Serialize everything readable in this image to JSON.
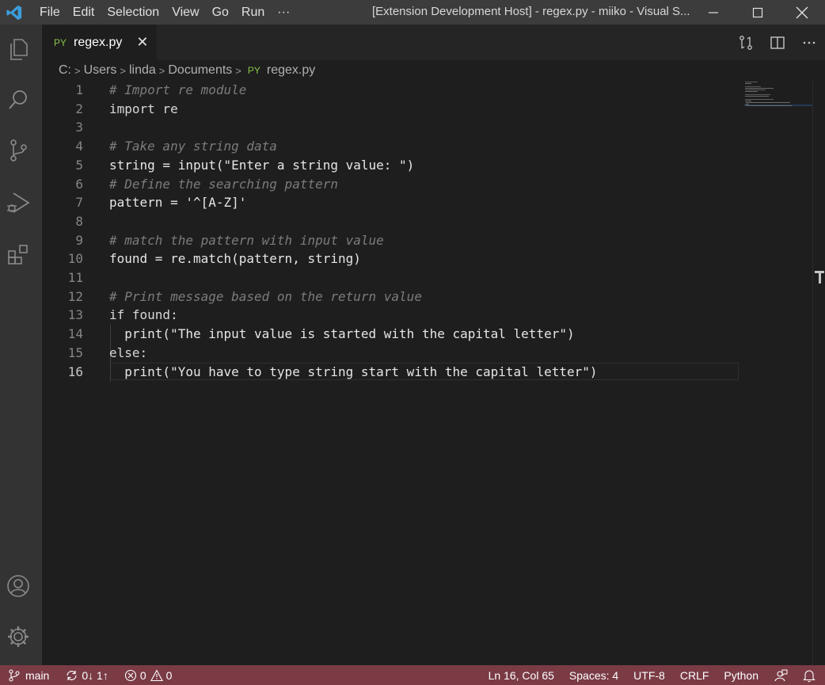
{
  "titlebar": {
    "menu": [
      "File",
      "Edit",
      "Selection",
      "View",
      "Go",
      "Run",
      "···"
    ],
    "window_title": "[Extension Development Host] - regex.py - miiko - Visual S..."
  },
  "tab": {
    "badge": "PY",
    "label": "regex.py"
  },
  "breadcrumb": {
    "parts": [
      "C:",
      "Users",
      "linda",
      "Documents"
    ],
    "file_badge": "PY",
    "file": "regex.py"
  },
  "editor": {
    "lines": [
      {
        "n": "1",
        "text": "# Import re module"
      },
      {
        "n": "2",
        "text": "import re"
      },
      {
        "n": "3",
        "text": ""
      },
      {
        "n": "4",
        "text": "# Take any string data"
      },
      {
        "n": "5",
        "text": "string = input(\"Enter a string value: \")"
      },
      {
        "n": "6",
        "text": "# Define the searching pattern"
      },
      {
        "n": "7",
        "text": "pattern = '^[A-Z]'"
      },
      {
        "n": "8",
        "text": ""
      },
      {
        "n": "9",
        "text": "# match the pattern with input value"
      },
      {
        "n": "10",
        "text": "found = re.match(pattern, string)"
      },
      {
        "n": "11",
        "text": ""
      },
      {
        "n": "12",
        "text": "# Print message based on the return value"
      },
      {
        "n": "13",
        "text": "if found:"
      },
      {
        "n": "14",
        "text": "  print(\"The input value is started with the capital letter\")"
      },
      {
        "n": "15",
        "text": "else:"
      },
      {
        "n": "16",
        "text": "  print(\"You have to type string start with the capital letter\")"
      }
    ]
  },
  "statusbar": {
    "branch": "main",
    "sync": "0↓ 1↑",
    "errors": "0",
    "warnings": "0",
    "position": "Ln 16, Col 65",
    "spaces": "Spaces: 4",
    "encoding": "UTF-8",
    "eol": "CRLF",
    "language": "Python"
  },
  "colors": {
    "titlebar": "#3c3c3c",
    "activitybar": "#333333",
    "editor_bg": "#1e1e1e",
    "statusbar": "#7a3b45",
    "py_badge": "#8bc34a",
    "function": "#6a9ee6",
    "comment": "#7c7c7c"
  }
}
